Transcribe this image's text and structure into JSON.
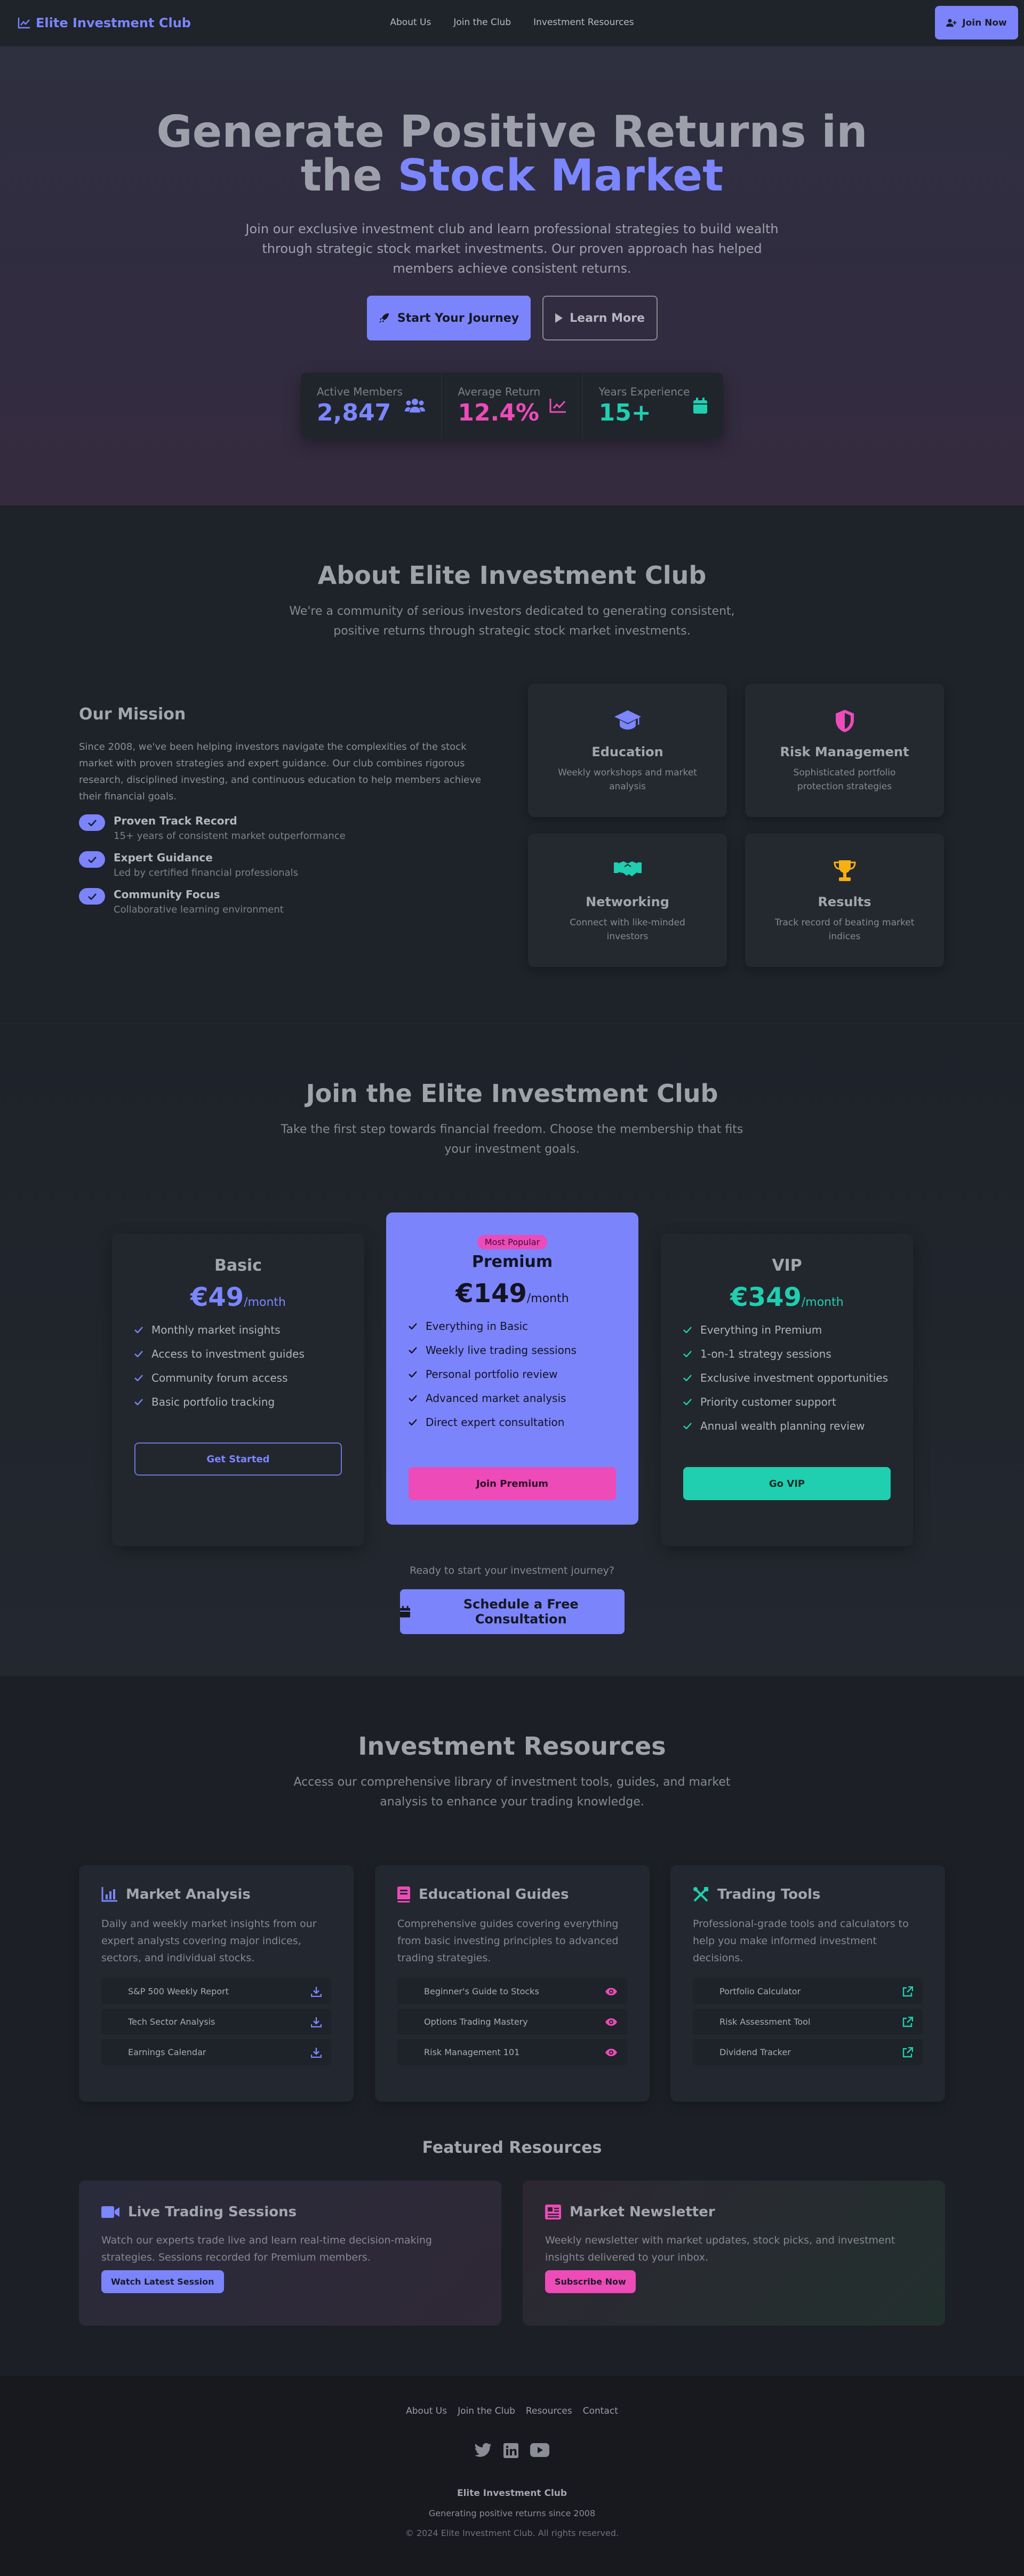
{
  "nav": {
    "brand": "Elite Investment Club",
    "links": [
      "About Us",
      "Join the Club",
      "Investment Resources"
    ],
    "cta": "Join Now"
  },
  "hero": {
    "title_line1": "Generate Positive Returns in",
    "title_line2_prefix": "the ",
    "title_line2_accent": "Stock Market",
    "subtitle": "Join our exclusive investment club and learn professional strategies to build wealth through strategic stock market investments. Our proven approach has helped members achieve consistent returns.",
    "primary_btn": "Start Your Journey",
    "secondary_btn": "Learn More",
    "stats": [
      {
        "label": "Active Members",
        "value": "2,847",
        "color": "#7b86ff",
        "icon": "users-icon"
      },
      {
        "label": "Average Return",
        "value": "12.4%",
        "color": "#ec4bb8",
        "icon": "chart-line-icon"
      },
      {
        "label": "Years Experience",
        "value": "15+",
        "color": "#1fcfb0",
        "icon": "calendar-icon"
      }
    ]
  },
  "about": {
    "title": "About Elite Investment Club",
    "subtitle": "We're a community of serious investors dedicated to generating consistent, positive returns through strategic stock market investments.",
    "mission_title": "Our Mission",
    "mission_text": "Since 2008, we've been helping investors navigate the complexities of the stock market with proven strategies and expert guidance. Our club combines rigorous research, disciplined investing, and continuous education to help members achieve their financial goals.",
    "points": [
      {
        "title": "Proven Track Record",
        "desc": "15+ years of consistent market outperformance"
      },
      {
        "title": "Expert Guidance",
        "desc": "Led by certified financial professionals"
      },
      {
        "title": "Community Focus",
        "desc": "Collaborative learning environment"
      }
    ],
    "cards": [
      {
        "title": "Education",
        "desc": "Weekly workshops and market analysis",
        "icon": "graduation-cap-icon",
        "color": "#7b86ff"
      },
      {
        "title": "Risk Management",
        "desc": "Sophisticated portfolio protection strategies",
        "icon": "shield-icon",
        "color": "#ec4bb8"
      },
      {
        "title": "Networking",
        "desc": "Connect with like-minded investors",
        "icon": "handshake-icon",
        "color": "#1fcfb0"
      },
      {
        "title": "Results",
        "desc": "Track record of beating market indices",
        "icon": "trophy-icon",
        "color": "#f5b014"
      }
    ]
  },
  "membership": {
    "title": "Join the Elite Investment Club",
    "subtitle": "Take the first step towards financial freedom. Choose the membership that fits your investment goals.",
    "plans": [
      {
        "name": "Basic",
        "price": "€49",
        "per": "/month",
        "features": [
          "Monthly market insights",
          "Access to investment guides",
          "Community forum access",
          "Basic portfolio tracking"
        ],
        "button": "Get Started"
      },
      {
        "badge": "Most Popular",
        "name": "Premium",
        "price": "€149",
        "per": "/month",
        "features": [
          "Everything in Basic",
          "Weekly live trading sessions",
          "Personal portfolio review",
          "Advanced market analysis",
          "Direct expert consultation"
        ],
        "button": "Join Premium"
      },
      {
        "name": "VIP",
        "price": "€349",
        "per": "/month",
        "features": [
          "Everything in Premium",
          "1-on-1 strategy sessions",
          "Exclusive investment opportunities",
          "Priority customer support",
          "Annual wealth planning review"
        ],
        "button": "Go VIP"
      }
    ],
    "consult_question": "Ready to start your investment journey?",
    "consult_btn": "Schedule a Free Consultation"
  },
  "resources": {
    "title": "Investment Resources",
    "subtitle": "Access our comprehensive library of investment tools, guides, and market analysis to enhance your trading knowledge.",
    "cards": [
      {
        "title": "Market Analysis",
        "desc": "Daily and weekly market insights from our expert analysts covering major indices, sectors, and individual stocks.",
        "items": [
          "S&P 500 Weekly Report",
          "Tech Sector Analysis",
          "Earnings Calendar"
        ],
        "icon": "chart-bar-icon",
        "item_icon": "download-icon",
        "color": "#7b86ff"
      },
      {
        "title": "Educational Guides",
        "desc": "Comprehensive guides covering everything from basic investing principles to advanced trading strategies.",
        "items": [
          "Beginner's Guide to Stocks",
          "Options Trading Mastery",
          "Risk Management 101"
        ],
        "icon": "book-icon",
        "item_icon": "eye-icon",
        "color": "#ec4bb8"
      },
      {
        "title": "Trading Tools",
        "desc": "Professional-grade tools and calculators to help you make informed investment decisions.",
        "items": [
          "Portfolio Calculator",
          "Risk Assessment Tool",
          "Dividend Tracker"
        ],
        "icon": "tools-icon",
        "item_icon": "external-link-icon",
        "color": "#1fcfb0"
      }
    ],
    "featured_title": "Featured Resources",
    "featured": [
      {
        "title": "Live Trading Sessions",
        "desc": "Watch our experts trade live and learn real-time decision-making strategies. Sessions recorded for Premium members.",
        "button": "Watch Latest Session",
        "icon": "video-icon",
        "color": "#7b86ff"
      },
      {
        "title": "Market Newsletter",
        "desc": "Weekly newsletter with market updates, stock picks, and investment insights delivered to your inbox.",
        "button": "Subscribe Now",
        "icon": "newspaper-icon",
        "color": "#ec4bb8"
      }
    ]
  },
  "footer": {
    "links": [
      "About Us",
      "Join the Club",
      "Resources",
      "Contact"
    ],
    "socials": [
      "twitter-icon",
      "linkedin-icon",
      "youtube-icon"
    ],
    "name": "Elite Investment Club",
    "tagline": "Generating positive returns since 2008",
    "copyright": "© 2024 Elite Investment Club. All rights reserved."
  }
}
